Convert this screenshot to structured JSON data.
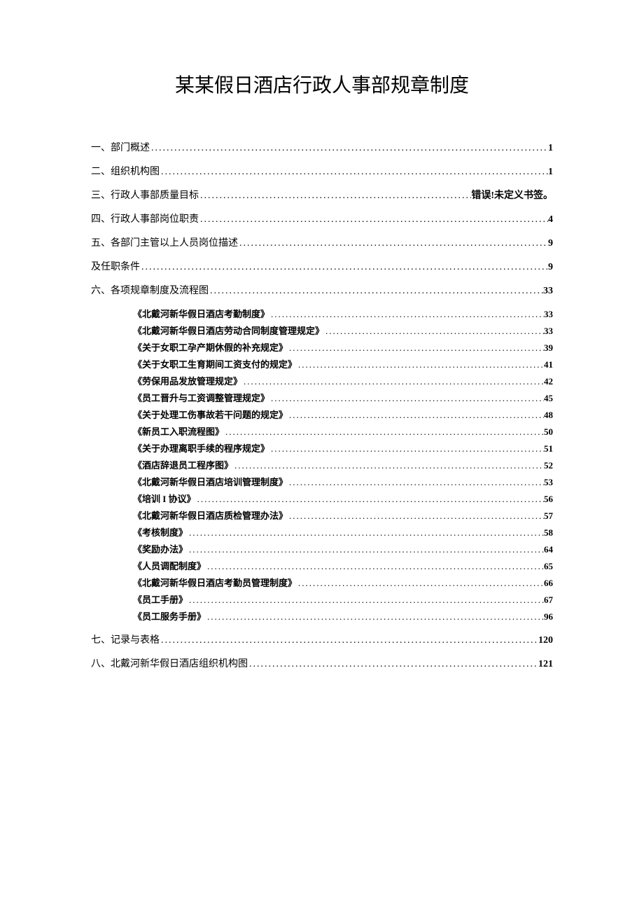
{
  "title": "某某假日酒店行政人事部规章制度",
  "toc": [
    {
      "level": 1,
      "text": "一、部门概述",
      "page": "1"
    },
    {
      "level": 1,
      "text": "二、组织机构图",
      "page": "1"
    },
    {
      "level": 1,
      "text": "三、行政人事部质量目标",
      "page": "错误!未定义书签。"
    },
    {
      "level": 1,
      "text": "四、行政人事部岗位职责",
      "page": "4"
    },
    {
      "level": 1,
      "text": "五、各部门主管以上人员岗位描述",
      "page": "9"
    },
    {
      "level": 1,
      "text": "及任职条件",
      "page": "9"
    },
    {
      "level": 1,
      "text": "六、各项规章制度及流程图",
      "page": "33"
    },
    {
      "level": 2,
      "text": "《北戴河新华假日酒店考勤制度》",
      "page": "33"
    },
    {
      "level": 2,
      "text": "《北戴河新华假日酒店劳动合同制度管理规定》",
      "page": "33"
    },
    {
      "level": 2,
      "text": "《关于女职工孕产期休假的补充规定》",
      "page": "39"
    },
    {
      "level": 2,
      "text": "《关于女职工生育期间工资支付的规定》",
      "page": "41"
    },
    {
      "level": 2,
      "text": "《劳保用品发放管理规定》",
      "page": "42"
    },
    {
      "level": 2,
      "text": "《员工晋升与工资调整管理规定》",
      "page": "45"
    },
    {
      "level": 2,
      "text": "《关于处理工伤事故若干问题的规定》",
      "page": "48"
    },
    {
      "level": 2,
      "text": "《新员工入职流程图》",
      "page": "50"
    },
    {
      "level": 2,
      "text": "《关于办理离职手续的程序规定》",
      "page": "51"
    },
    {
      "level": 2,
      "text": "《酒店辞退员工程序图》",
      "page": "52"
    },
    {
      "level": 2,
      "text": "《北戴河新华假日酒店培训管理制度》",
      "page": "53"
    },
    {
      "level": 2,
      "text": "《培训 I 协议》",
      "page": "56"
    },
    {
      "level": 2,
      "text": "《北戴河新华假日酒店质检管理办法》",
      "page": "57"
    },
    {
      "level": 2,
      "text": "《考核制度》",
      "page": "58"
    },
    {
      "level": 2,
      "text": "《奖励办法》",
      "page": "64"
    },
    {
      "level": 2,
      "text": "《人员调配制度》",
      "page": "65"
    },
    {
      "level": 2,
      "text": "《北戴河新华假日酒店考勤员管理制度》",
      "page": "66"
    },
    {
      "level": 2,
      "text": "《员工手册》",
      "page": "67"
    },
    {
      "level": 2,
      "text": "《员工服务手册》",
      "page": "96"
    },
    {
      "level": 1,
      "text": "七、记录与表格",
      "page": "120"
    },
    {
      "level": 1,
      "text": "八、北戴河新华假日酒店组织机构图",
      "page": "121"
    }
  ]
}
